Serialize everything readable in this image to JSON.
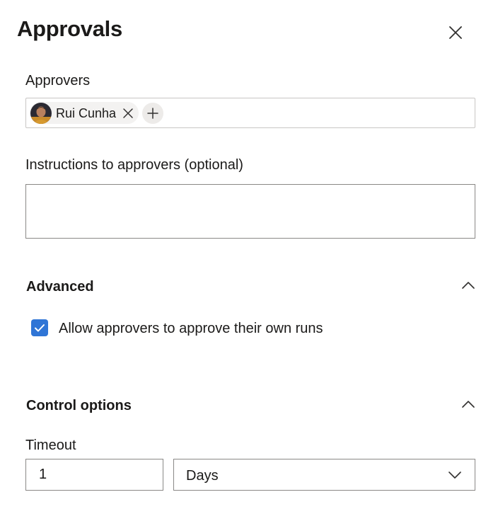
{
  "panel": {
    "title": "Approvals"
  },
  "approvers": {
    "label": "Approvers",
    "chips": [
      {
        "name": "Rui Cunha"
      }
    ]
  },
  "instructions": {
    "label": "Instructions to approvers (optional)",
    "value": ""
  },
  "advanced": {
    "title": "Advanced",
    "expanded": true,
    "allow_self_approve": {
      "label": "Allow approvers to approve their own runs",
      "checked": true
    }
  },
  "control_options": {
    "title": "Control options",
    "expanded": true,
    "timeout": {
      "label": "Timeout",
      "value": "1",
      "unit": "Days"
    }
  },
  "colors": {
    "accent": "#2f75d6",
    "border": "#c8c6c4",
    "chip_bg": "#f3f2f1"
  }
}
